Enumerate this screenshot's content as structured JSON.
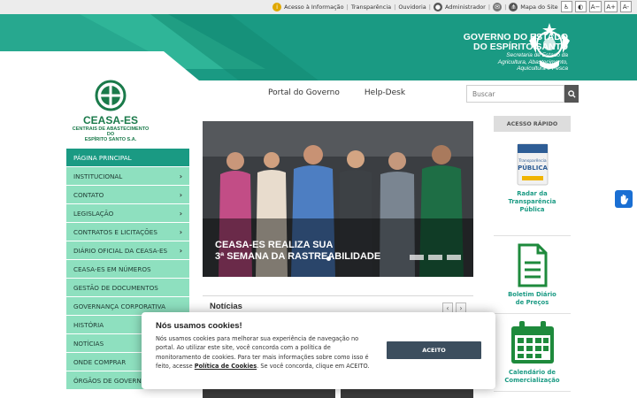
{
  "topbar": {
    "links": [
      "Acesso à Informação",
      "Transparência",
      "Ouvidoria",
      "Administrador",
      "Mapa do Site"
    ],
    "font_controls": [
      "A−",
      "A+",
      "A-"
    ],
    "icons": [
      "info-icon",
      "user-icon",
      "mail-icon",
      "sitemap-icon",
      "accessibility-icon",
      "contrast-icon"
    ]
  },
  "banner": {
    "title_line1": "GOVERNO DO ESTADO",
    "title_line2": "DO ESPÍRITO SANTO",
    "subtitle_line1": "Secretaria de Estado da",
    "subtitle_line2": "Agricultura, Abastecimento,",
    "subtitle_line3": "Aquicultura e Pesca"
  },
  "logo": {
    "name": "CEASA-ES",
    "full_line1": "CENTRAIS DE ABASTECIMENTO DO",
    "full_line2": "ESPÍRITO SANTO S.A."
  },
  "nav": {
    "items": [
      "Portal do Governo",
      "Help-Desk"
    ],
    "search_placeholder": "Buscar"
  },
  "sidebar": {
    "items": [
      {
        "label": "Página Principal",
        "chevron": ""
      },
      {
        "label": "Institucional",
        "chevron": "›"
      },
      {
        "label": "Contato",
        "chevron": "›"
      },
      {
        "label": "Legislação",
        "chevron": "›"
      },
      {
        "label": "Contratos e Licitações",
        "chevron": "›"
      },
      {
        "label": "Diário Oficial da CEASA-ES",
        "chevron": "›"
      },
      {
        "label": "CEASA-ES em Números",
        "chevron": ""
      },
      {
        "label": "Gestão de Documentos",
        "chevron": ""
      },
      {
        "label": "Governança Corporativa",
        "chevron": ""
      },
      {
        "label": "História",
        "chevron": ""
      },
      {
        "label": "Notícias",
        "chevron": ""
      },
      {
        "label": "Onde Comprar",
        "chevron": ""
      },
      {
        "label": "Órgãos de Governa",
        "chevron": ""
      }
    ]
  },
  "hero": {
    "caption_line1": "CEASA-ES REALIZA SUA",
    "caption_line2": "3ª SEMANA DA RASTREABILIDADE"
  },
  "news": {
    "title": "Notícias",
    "prev": "‹",
    "next": "›"
  },
  "quick_access": {
    "title": "ACESSO RÁPIDO",
    "items": [
      {
        "label_line1": "Radar da",
        "label_line2": "Transparência",
        "label_line3": "Pública",
        "icon": "radar-transparencia-icon"
      },
      {
        "label_line1": "Boletim Diário",
        "label_line2": "de Preços",
        "label_line3": "",
        "icon": "document-icon"
      },
      {
        "label_line1": "Calendário de",
        "label_line2": "Comercialização",
        "label_line3": "",
        "icon": "calendar-icon"
      }
    ],
    "radar_card_text_1": "Transparência",
    "radar_card_text_2": "PÚBLICA"
  },
  "cookie": {
    "title": "Nós usamos cookies!",
    "text_part1": "Nós usamos cookies para melhorar sua experiência de navegação no portal. Ao utilizar este site, você concorda com a política de monitoramento de cookies. Para ter mais informações sobre como isso é feito, acesse ",
    "link": "Política de Cookies",
    "text_part2": ". Se você concorda, clique em ACEITO.",
    "button": "ACEITO"
  },
  "colors": {
    "brand_green": "#1a9a83",
    "menu_green": "#8ee0bf",
    "logo_green": "#1a7a4a",
    "quick_green": "#1e8a3c",
    "cookie_button": "#3c4e5e"
  }
}
